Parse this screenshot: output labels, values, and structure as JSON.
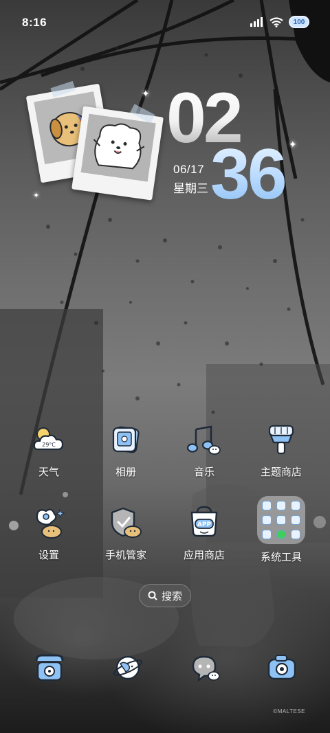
{
  "status_bar": {
    "time": "8:16",
    "battery_text": "100",
    "icons": [
      "signal-icon",
      "wifi-icon",
      "battery-icon"
    ]
  },
  "clock_widget": {
    "hour": "02",
    "minute": "36",
    "date": "06/17",
    "weekday": "星期三"
  },
  "apps": [
    {
      "label": "天气",
      "icon": "weather-icon",
      "temp": "29°C"
    },
    {
      "label": "相册",
      "icon": "gallery-icon"
    },
    {
      "label": "音乐",
      "icon": "music-icon"
    },
    {
      "label": "主题商店",
      "icon": "theme-store-icon"
    },
    {
      "label": "设置",
      "icon": "settings-icon"
    },
    {
      "label": "手机管家",
      "icon": "security-icon"
    },
    {
      "label": "应用商店",
      "icon": "app-store-icon",
      "badge": "APP"
    },
    {
      "label": "系统工具",
      "icon": "system-tools-folder"
    }
  ],
  "search": {
    "label": "搜索"
  },
  "dock": [
    {
      "icon": "phone-icon"
    },
    {
      "icon": "browser-icon"
    },
    {
      "icon": "messages-icon"
    },
    {
      "icon": "camera-icon"
    }
  ],
  "watermark": "©MALTESE",
  "colors": {
    "accent_blue": "#8ec1f4",
    "icon_outline": "#1e2a38",
    "icon_fill": "#ffffff"
  }
}
